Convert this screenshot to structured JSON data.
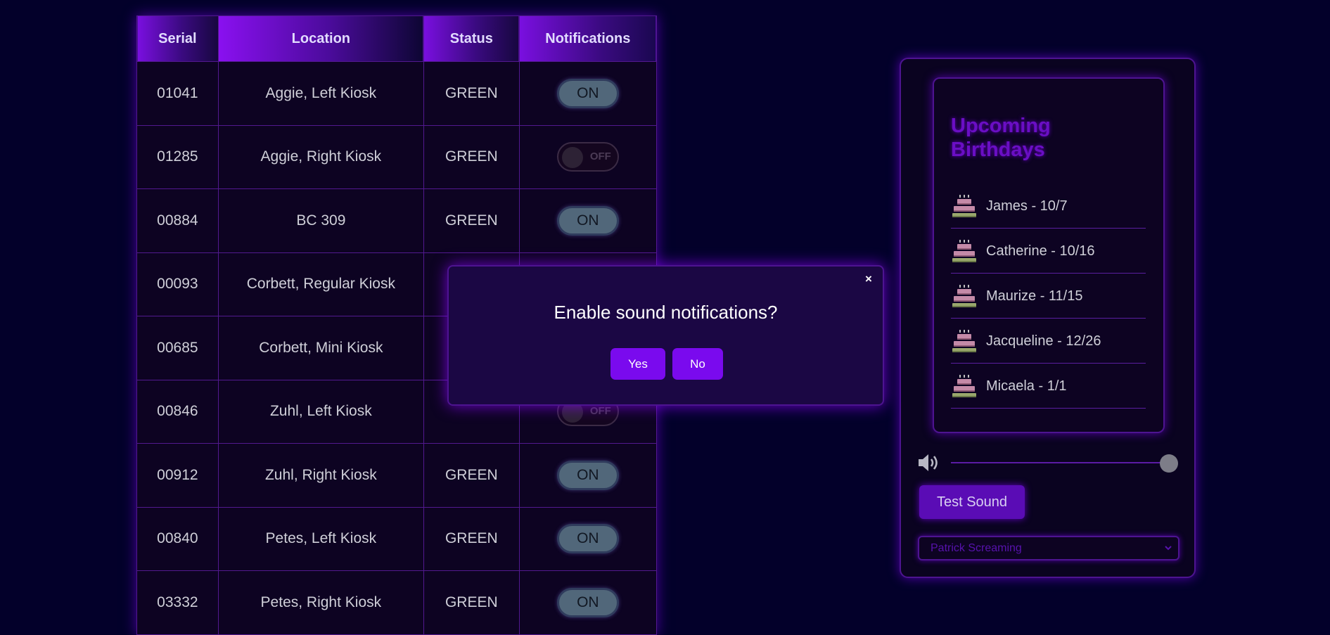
{
  "table": {
    "headers": [
      "Serial",
      "Location",
      "Status",
      "Notifications"
    ],
    "rows": [
      {
        "serial": "01041",
        "location": "Aggie, Left Kiosk",
        "status": "GREEN",
        "notify": "ON"
      },
      {
        "serial": "01285",
        "location": "Aggie, Right Kiosk",
        "status": "GREEN",
        "notify": "OFF"
      },
      {
        "serial": "00884",
        "location": "BC 309",
        "status": "GREEN",
        "notify": "ON"
      },
      {
        "serial": "00093",
        "location": "Corbett, Regular Kiosk",
        "status": "",
        "notify": ""
      },
      {
        "serial": "00685",
        "location": "Corbett, Mini Kiosk",
        "status": "",
        "notify": ""
      },
      {
        "serial": "00846",
        "location": "Zuhl, Left Kiosk",
        "status": "",
        "notify": "OFF"
      },
      {
        "serial": "00912",
        "location": "Zuhl, Right Kiosk",
        "status": "GREEN",
        "notify": "ON"
      },
      {
        "serial": "00840",
        "location": "Petes, Left Kiosk",
        "status": "GREEN",
        "notify": "ON"
      },
      {
        "serial": "03332",
        "location": "Petes, Right Kiosk",
        "status": "GREEN",
        "notify": "ON"
      }
    ]
  },
  "birthdays": {
    "title": "Upcoming Birthdays",
    "items": [
      {
        "label": "James - 10/7"
      },
      {
        "label": "Catherine - 10/16"
      },
      {
        "label": "Maurize - 11/15"
      },
      {
        "label": "Jacqueline - 12/26"
      },
      {
        "label": "Micaela - 1/1"
      }
    ]
  },
  "sound": {
    "volume_level": 1.0,
    "test_label": "Test Sound",
    "selected": "Patrick Screaming"
  },
  "modal": {
    "close_label": "×",
    "title": "Enable sound notifications?",
    "yes_label": "Yes",
    "no_label": "No"
  },
  "colors": {
    "background": "#03002a",
    "accent": "#7a0aee",
    "toggle_on": "#51677a"
  },
  "icons": {
    "birthday": "cake-icon",
    "volume": "speaker-icon",
    "close": "close-icon",
    "dropdown": "chevron-down-icon"
  }
}
